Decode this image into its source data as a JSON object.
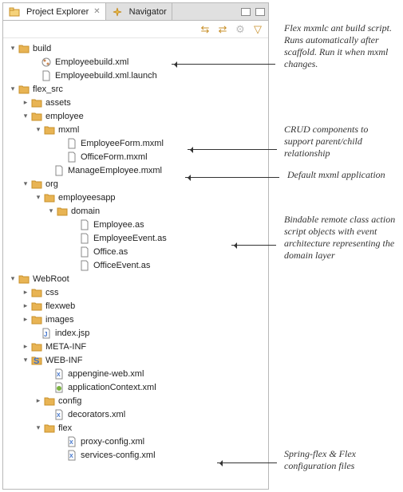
{
  "tabs": {
    "project_explorer": "Project Explorer",
    "navigator": "Navigator"
  },
  "tree": {
    "build": "build",
    "employeebuild_xml": "Employeebuild.xml",
    "employeebuild_launch": "Employeebuild.xml.launch",
    "flex_src": "flex_src",
    "assets": "assets",
    "employee": "employee",
    "mxml": "mxml",
    "employee_form": "EmployeeForm.mxml",
    "office_form": "OfficeForm.mxml",
    "manage_employee": "ManageEmployee.mxml",
    "org": "org",
    "employeesapp": "employeesapp",
    "domain": "domain",
    "employee_as": "Employee.as",
    "employee_event_as": "EmployeeEvent.as",
    "office_as": "Office.as",
    "office_event_as": "OfficeEvent.as",
    "webroot": "WebRoot",
    "css": "css",
    "flexweb": "flexweb",
    "images": "images",
    "index_jsp": "index.jsp",
    "meta_inf": "META-INF",
    "web_inf": "WEB-INF",
    "appengine": "appengine-web.xml",
    "app_context": "applicationContext.xml",
    "config": "config",
    "decorators": "decorators.xml",
    "flex": "flex",
    "proxy_config": "proxy-config.xml",
    "services_config": "services-config.xml"
  },
  "annotations": {
    "a1": "Flex mxmlc ant build script. Runs automatically after scaffold. Run it when mxml changes.",
    "a2": "CRUD components to support parent/child relationship",
    "a3": "Default mxml application",
    "a4": "Bindable remote class action script objects with event architecture representing the domain layer",
    "a5": "Spring-flex & Flex configuration files"
  }
}
